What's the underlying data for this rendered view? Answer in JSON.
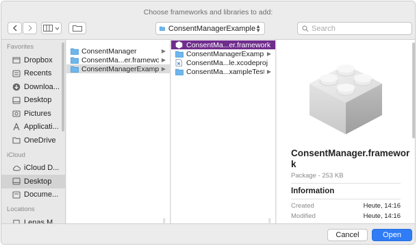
{
  "title": "Choose frameworks and libraries to add:",
  "toolbar": {
    "back": "back",
    "forward": "forward",
    "location": "ConsentManagerExample",
    "search_placeholder": "Search"
  },
  "sidebar": {
    "favorites_header": "Favorites",
    "favorites": [
      {
        "label": "Dropbox",
        "icon": "dropbox-icon"
      },
      {
        "label": "Recents",
        "icon": "recents-icon"
      },
      {
        "label": "Downloa...",
        "icon": "downloads-icon"
      },
      {
        "label": "Desktop",
        "icon": "desktop-icon"
      },
      {
        "label": "Pictures",
        "icon": "pictures-icon"
      },
      {
        "label": "Applicati...",
        "icon": "applications-icon"
      },
      {
        "label": "OneDrive",
        "icon": "folder-icon"
      }
    ],
    "icloud_header": "iCloud",
    "icloud": [
      {
        "label": "iCloud D...",
        "icon": "cloud-icon"
      },
      {
        "label": "Desktop",
        "icon": "desktop-icon",
        "selected": true
      },
      {
        "label": "Docume...",
        "icon": "documents-icon"
      }
    ],
    "locations_header": "Locations",
    "locations": [
      {
        "label": "Lenas M...",
        "icon": "laptop-icon"
      }
    ]
  },
  "column1": [
    {
      "label": "ConsentManager",
      "kind": "folder",
      "has_children": true
    },
    {
      "label": "ConsentMa...er.framework",
      "kind": "folder",
      "has_children": true
    },
    {
      "label": "ConsentManagerExample",
      "kind": "folder",
      "has_children": true,
      "selected": true
    }
  ],
  "column2": [
    {
      "label": "ConsentMa...er.framework",
      "kind": "framework",
      "has_children": false,
      "selected": true
    },
    {
      "label": "ConsentManagerExample",
      "kind": "folder",
      "has_children": true
    },
    {
      "label": "ConsentMa...le.xcodeproj",
      "kind": "xcodeproj",
      "has_children": false
    },
    {
      "label": "ConsentMa...xampleTests",
      "kind": "folder",
      "has_children": true
    }
  ],
  "preview": {
    "name": "ConsentManager.framework",
    "kind_size": "Package - 253 KB",
    "info_header": "Information",
    "created_label": "Created",
    "created_value": "Heute, 14:16",
    "modified_label": "Modified",
    "modified_value": "Heute, 14:16"
  },
  "buttons": {
    "cancel": "Cancel",
    "open": "Open"
  },
  "colors": {
    "accent": "#2f7cf6",
    "selection_purple": "#6f2d8c",
    "folder_blue": "#5aa9e6"
  }
}
